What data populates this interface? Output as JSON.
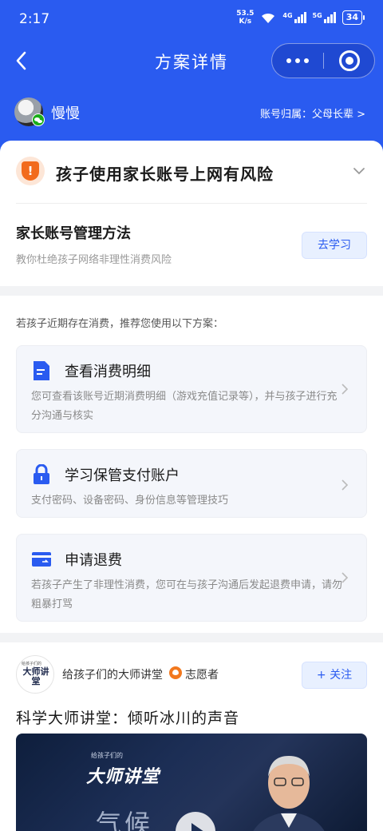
{
  "status_bar": {
    "time": "2:17",
    "net_speed_value": "53.5",
    "net_speed_unit": "K/s",
    "wifi_icon": "wifi-icon",
    "signal_4g": "4G",
    "signal_5g": "5G",
    "battery": "34"
  },
  "nav": {
    "title": "方案详情",
    "back_icon": "back-arrow-icon",
    "more_icon": "more-dots-icon",
    "close_icon": "target-close-icon"
  },
  "account": {
    "name": "慢慢",
    "owner_label": "账号归属：父母长辈 >"
  },
  "risk": {
    "title": "孩子使用家长账号上网有风险",
    "icon": "shield-warning-icon",
    "icon_glyph": "!"
  },
  "method": {
    "title": "家长账号管理方法",
    "subtitle": "教你杜绝孩子网络非理性消费风险",
    "button": "去学习"
  },
  "plans": {
    "intro": "若孩子近期存在消费，推荐您使用以下方案：",
    "items": [
      {
        "icon": "document-icon",
        "title": "查看消费明细",
        "desc": "您可查看该账号近期消费明细（游戏充值记录等），并与孩子进行充分沟通与核实"
      },
      {
        "icon": "lock-icon",
        "title": "学习保管支付账户",
        "desc": "支付密码、设备密码、身份信息等管理技巧"
      },
      {
        "icon": "refund-card-icon",
        "title": "申请退费",
        "desc": "若孩子产生了非理性消费，您可在与孩子沟通后发起退费申请，请勿粗暴打骂"
      }
    ]
  },
  "lecture": {
    "logo_small": "给孩子们的",
    "logo_text": "大师讲堂",
    "author": "给孩子们的大师讲堂",
    "volunteer": "志愿者",
    "follow": "+ 关注",
    "title": "科学大师讲堂：倾听冰川的声音",
    "video_brand_small": "给孩子们的",
    "video_brand": "大师讲堂",
    "video_word": "气候"
  },
  "colors": {
    "primary": "#2a5bf0",
    "warning": "#f26b1d",
    "volunteer": "#f2781e",
    "wechat": "#1aad19"
  }
}
